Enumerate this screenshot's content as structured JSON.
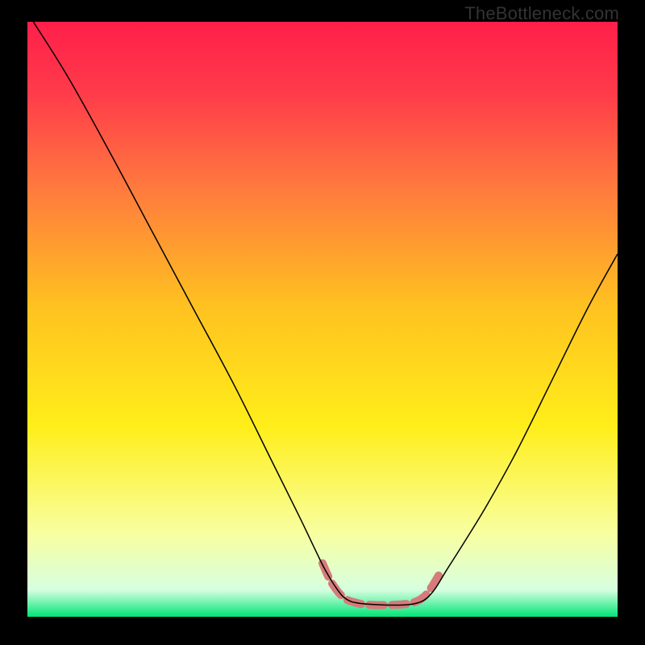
{
  "watermark": "TheBottleneck.com",
  "chart_data": {
    "type": "line",
    "title": "",
    "xlabel": "",
    "ylabel": "",
    "xlim": [
      0,
      100
    ],
    "ylim": [
      0,
      100
    ],
    "gradient_stops": [
      {
        "offset": 0,
        "color": "#ff1f4a"
      },
      {
        "offset": 0.12,
        "color": "#ff3b4a"
      },
      {
        "offset": 0.28,
        "color": "#ff7a3e"
      },
      {
        "offset": 0.48,
        "color": "#ffc220"
      },
      {
        "offset": 0.68,
        "color": "#ffee1a"
      },
      {
        "offset": 0.86,
        "color": "#f8ffa0"
      },
      {
        "offset": 0.955,
        "color": "#d6ffe0"
      },
      {
        "offset": 1,
        "color": "#00e676"
      }
    ],
    "series": [
      {
        "name": "bottleneck-curve",
        "type": "line",
        "color": "#000000",
        "stroke_width": 1.5,
        "points": [
          {
            "x": 1,
            "y": 100
          },
          {
            "x": 7,
            "y": 90.5
          },
          {
            "x": 14,
            "y": 78
          },
          {
            "x": 21,
            "y": 65
          },
          {
            "x": 28,
            "y": 52
          },
          {
            "x": 35,
            "y": 39
          },
          {
            "x": 41,
            "y": 27
          },
          {
            "x": 46,
            "y": 17
          },
          {
            "x": 48.8,
            "y": 11.2
          },
          {
            "x": 50.5,
            "y": 7.8
          },
          {
            "x": 52.5,
            "y": 4.6
          },
          {
            "x": 54,
            "y": 3.0
          },
          {
            "x": 56,
            "y": 2.3
          },
          {
            "x": 60,
            "y": 2.0
          },
          {
            "x": 64,
            "y": 2.0
          },
          {
            "x": 66,
            "y": 2.3
          },
          {
            "x": 67.5,
            "y": 3.0
          },
          {
            "x": 69,
            "y": 4.6
          },
          {
            "x": 71,
            "y": 7.8
          },
          {
            "x": 74,
            "y": 12.5
          },
          {
            "x": 78,
            "y": 19
          },
          {
            "x": 83,
            "y": 28
          },
          {
            "x": 89,
            "y": 40
          },
          {
            "x": 95,
            "y": 52
          },
          {
            "x": 100,
            "y": 61
          }
        ]
      },
      {
        "name": "optimal-zone-highlight",
        "type": "line",
        "color": "#d67b7b",
        "stroke_width": 10,
        "dash": [
          18,
          10
        ],
        "points": [
          {
            "x": 50,
            "y": 9.0
          },
          {
            "x": 51.5,
            "y": 5.8
          },
          {
            "x": 53.5,
            "y": 3.3
          },
          {
            "x": 55.5,
            "y": 2.4
          },
          {
            "x": 58,
            "y": 2.0
          },
          {
            "x": 62,
            "y": 2.0
          },
          {
            "x": 65,
            "y": 2.3
          },
          {
            "x": 67,
            "y": 3.2
          },
          {
            "x": 68.5,
            "y": 5.0
          },
          {
            "x": 70,
            "y": 7.5
          }
        ]
      }
    ]
  }
}
